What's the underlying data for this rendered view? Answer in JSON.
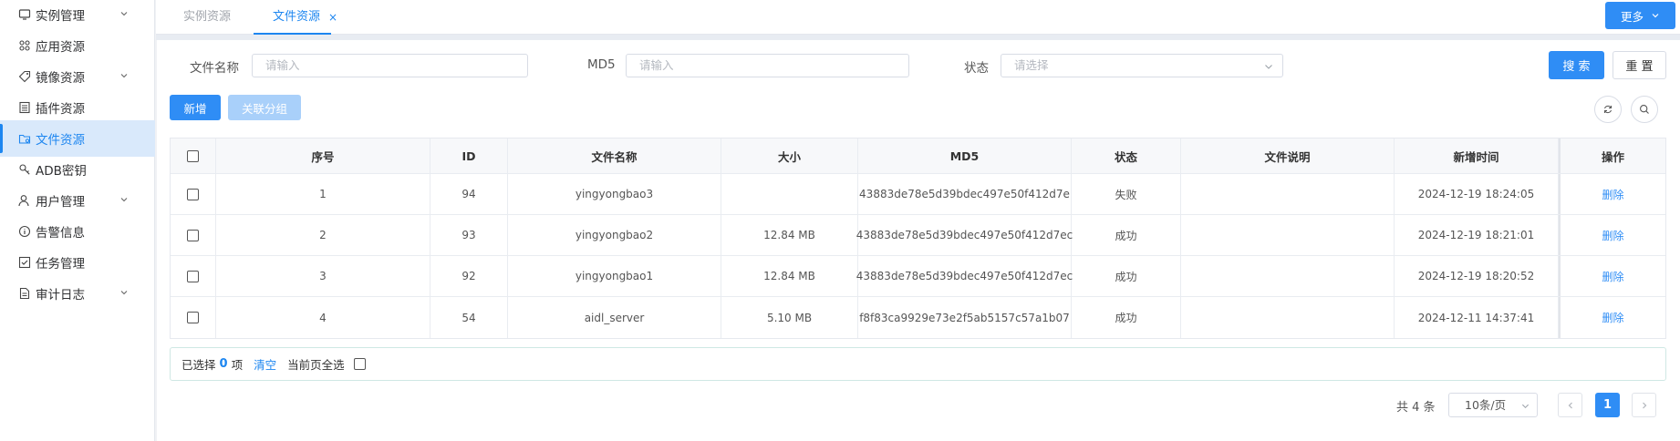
{
  "sidebar": {
    "items": [
      {
        "label": "实例管理",
        "icon": "monitor-icon",
        "expandable": true
      },
      {
        "label": "应用资源",
        "icon": "apps-grid-icon",
        "expandable": false
      },
      {
        "label": "镜像资源",
        "icon": "tag-icon",
        "expandable": true
      },
      {
        "label": "插件资源",
        "icon": "list-icon",
        "expandable": false
      },
      {
        "label": "文件资源",
        "icon": "folder-icon",
        "expandable": false,
        "active": true
      },
      {
        "label": "ADB密钥",
        "icon": "key-icon",
        "expandable": false
      },
      {
        "label": "用户管理",
        "icon": "user-icon",
        "expandable": true
      },
      {
        "label": "告警信息",
        "icon": "info-icon",
        "expandable": false
      },
      {
        "label": "任务管理",
        "icon": "checkbox-icon",
        "expandable": false
      },
      {
        "label": "审计日志",
        "icon": "document-icon",
        "expandable": true
      }
    ]
  },
  "tabs": {
    "items": [
      {
        "label": "实例资源",
        "active": false
      },
      {
        "label": "文件资源",
        "active": true
      }
    ],
    "close_symbol": "×",
    "more_label": "更多"
  },
  "search": {
    "filename_label": "文件名称",
    "filename_placeholder": "请输入",
    "md5_label": "MD5",
    "md5_placeholder": "请输入",
    "status_label": "状态",
    "status_placeholder": "请选择",
    "search_button": "搜 索",
    "reset_button": "重 置"
  },
  "toolbar": {
    "add_button": "新增",
    "link_group_button": "关联分组"
  },
  "table": {
    "headers": [
      "序号",
      "ID",
      "文件名称",
      "大小",
      "MD5",
      "状态",
      "文件说明",
      "新增时间",
      "操作"
    ],
    "rows": [
      {
        "index": "1",
        "id": "94",
        "name": "yingyongbao3",
        "size": "",
        "md5": "43883de78e5d39bdec497e50f412d7e",
        "status": "失败",
        "desc": "",
        "time": "2024-12-19 18:24:05",
        "action": "删除"
      },
      {
        "index": "2",
        "id": "93",
        "name": "yingyongbao2",
        "size": "12.84 MB",
        "md5": "43883de78e5d39bdec497e50f412d7ec",
        "status": "成功",
        "desc": "",
        "time": "2024-12-19 18:21:01",
        "action": "删除"
      },
      {
        "index": "3",
        "id": "92",
        "name": "yingyongbao1",
        "size": "12.84 MB",
        "md5": "43883de78e5d39bdec497e50f412d7ec",
        "status": "成功",
        "desc": "",
        "time": "2024-12-19 18:20:52",
        "action": "删除"
      },
      {
        "index": "4",
        "id": "54",
        "name": "aidl_server",
        "size": "5.10 MB",
        "md5": "f8f83ca9929e73e2f5ab5157c57a1b07",
        "status": "成功",
        "desc": "",
        "time": "2024-12-11 14:37:41",
        "action": "删除"
      }
    ]
  },
  "selection": {
    "prefix": "已选择",
    "count": "0",
    "suffix": "项",
    "clear_label": "清空",
    "select_page_label": "当前页全选"
  },
  "pagination": {
    "total_text": "共 4 条",
    "page_size": "10条/页",
    "current_page": "1"
  },
  "colors": {
    "accent": "#2f8df5",
    "active_bg": "#d9e9fb"
  }
}
